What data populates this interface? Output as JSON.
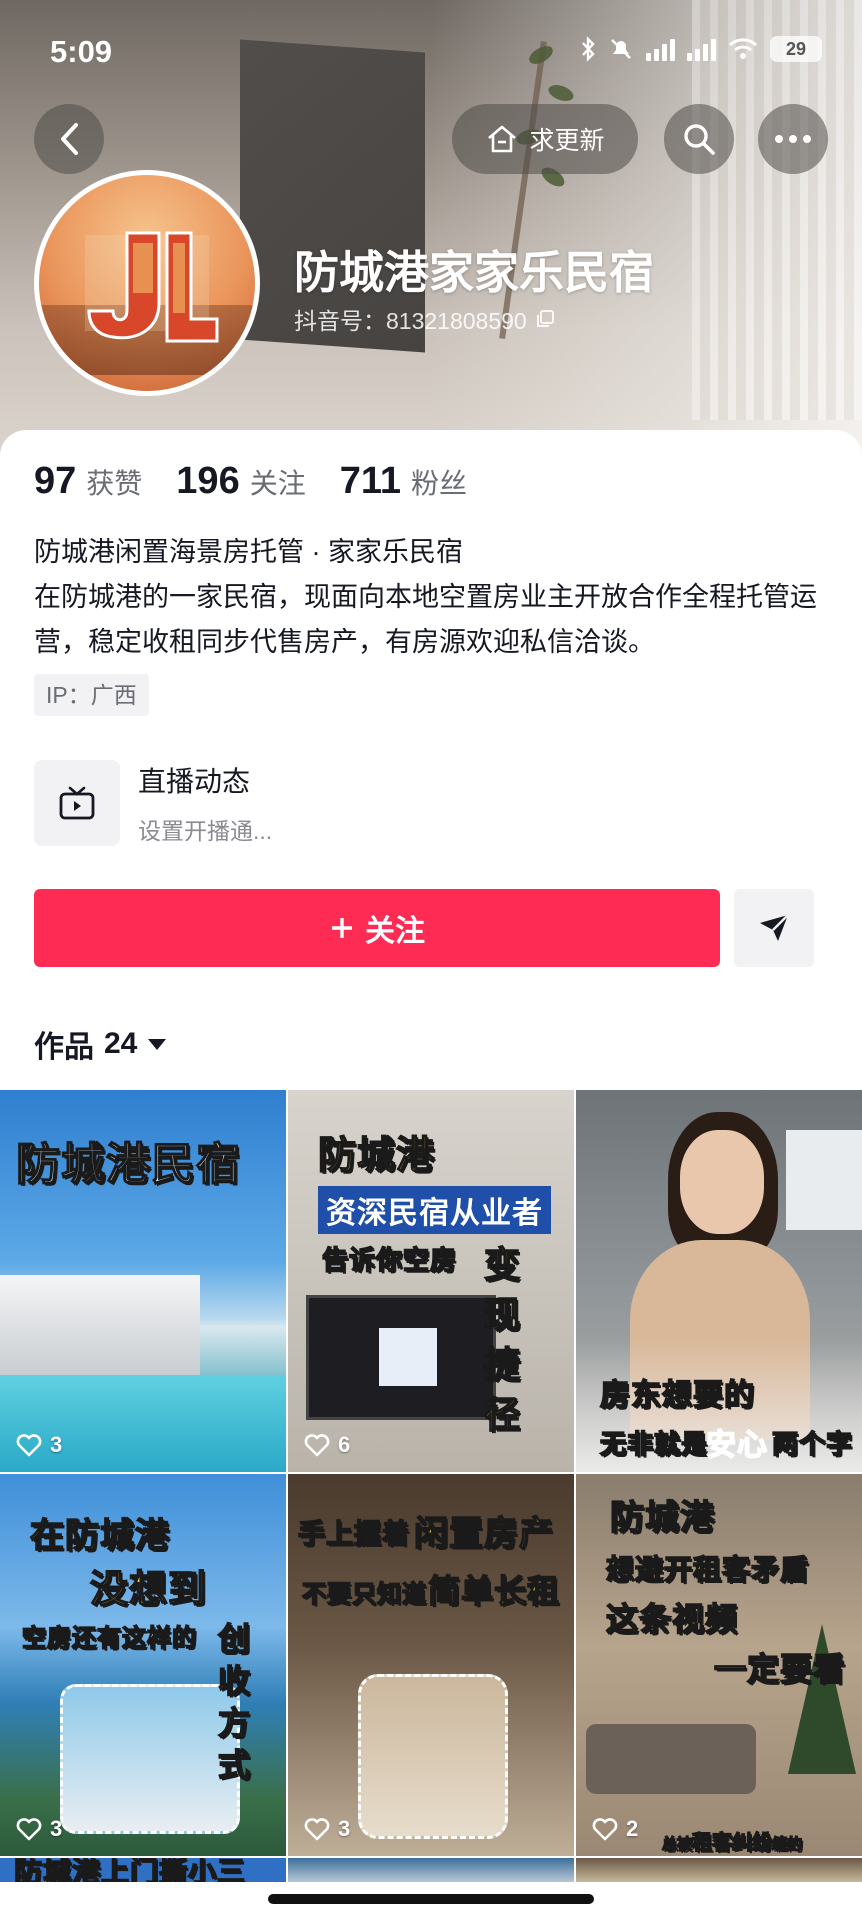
{
  "status_bar": {
    "time": "5:09",
    "battery": "29",
    "icons": [
      "bluetooth-icon",
      "mute-icon",
      "signal-icon",
      "signal-icon",
      "wifi-icon",
      "battery-icon"
    ]
  },
  "header": {
    "update_label": "求更新",
    "icons": [
      "back-icon",
      "house-icon",
      "search-icon",
      "more-icon"
    ]
  },
  "profile": {
    "name": "防城港家家乐民宿",
    "douyin_id": "抖音号：81321808590",
    "avatar_initials": "JL"
  },
  "stats": [
    {
      "value": "97",
      "label": "获赞"
    },
    {
      "value": "196",
      "label": "关注"
    },
    {
      "value": "711",
      "label": "粉丝"
    }
  ],
  "bio": {
    "line1": "防城港闲置海景房托管 · 家家乐民宿",
    "line2": "在防城港的一家民宿，现面向本地空置房业主开放合作全程托管运营，稳定收租同步代售房产，有房源欢迎私信洽谈。"
  },
  "ip_tag": "IP：广西",
  "live": {
    "title": "直播动态",
    "subtitle": "设置开播通..."
  },
  "actions": {
    "follow_label": "关注",
    "follow_color": "#fe2c55"
  },
  "works": {
    "label": "作品",
    "count": "24"
  },
  "videos": [
    {
      "likes": "3",
      "captions": [
        "防城港民宿"
      ]
    },
    {
      "likes": "6",
      "captions": [
        "防城港",
        "资深民宿从业者",
        "告诉你空房",
        "变",
        "现",
        "捷",
        "径"
      ]
    },
    {
      "likes": "",
      "captions": [
        "房东想要的",
        "无非就是",
        "安心",
        "两个字"
      ]
    },
    {
      "likes": "3",
      "captions": [
        "在防城港",
        "没想到",
        "空房还有这样的",
        "创",
        "收",
        "方",
        "式"
      ]
    },
    {
      "likes": "3",
      "captions": [
        "手上握着",
        "闲置房产",
        "不要只知道",
        "简单长租"
      ]
    },
    {
      "likes": "2",
      "captions": [
        "防城港",
        "想避开租客矛盾",
        "这条视频",
        "一定要看",
        "总被",
        "租客纠纷",
        "缠的"
      ]
    }
  ],
  "next_row_caption": "防城港上门撕小三"
}
